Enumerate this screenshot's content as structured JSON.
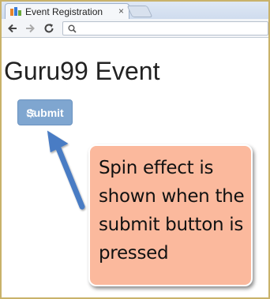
{
  "browser": {
    "tab_title": "Event Registration",
    "tab_close": "×",
    "address": ""
  },
  "page": {
    "heading": "Guru99 Event",
    "submit_label": "Submit"
  },
  "annotation": {
    "callout_text": "Spin effect is shown when the submit button is pressed"
  },
  "colors": {
    "button": "#7fa6d0",
    "callout": "#fbb99d",
    "arrow": "#4a7cc4",
    "frame": "#c9b26a"
  },
  "icons": {
    "back": "arrow-left-icon",
    "forward": "arrow-right-icon",
    "reload": "reload-icon",
    "search": "search-icon",
    "favicon": "favicon-icon",
    "spinner": "spinner-icon"
  }
}
